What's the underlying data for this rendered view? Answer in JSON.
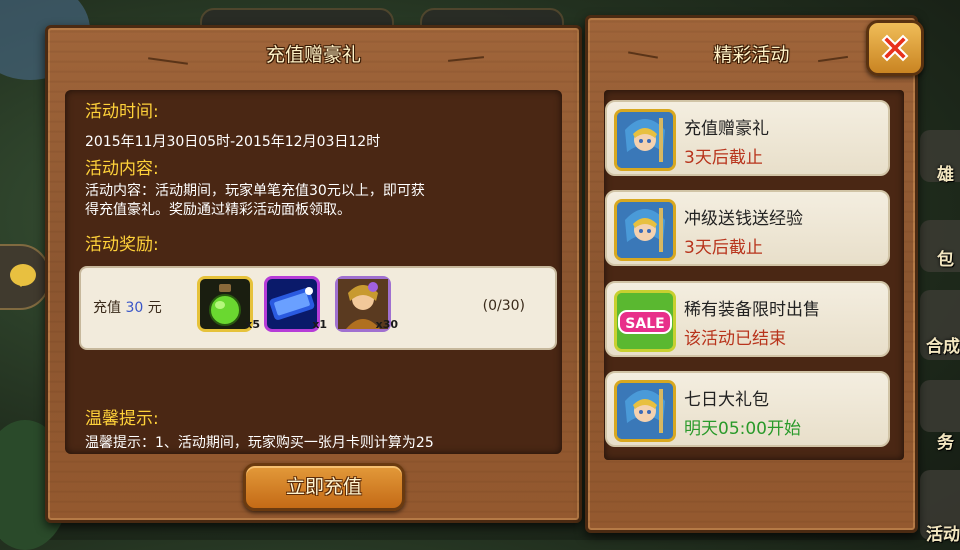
{
  "background": {
    "side_labels": [
      "雄",
      "包",
      "合成",
      "务",
      "活动"
    ]
  },
  "left_panel": {
    "title": "充值赠豪礼",
    "time_heading": "活动时间:",
    "time_text": "2015年11月30日05时-2015年12月03日12时",
    "content_heading": "活动内容:",
    "content_line1": "活动内容：活动期间，玩家单笔充值30元以上，即可获",
    "content_line2": "得充值豪礼。奖励通过精彩活动面板领取。",
    "reward_heading": "活动奖励:",
    "reward_row": {
      "label_prefix": "充值",
      "amount": "30",
      "label_suffix": "元",
      "items": [
        {
          "icon": "green-potion-icon",
          "count": "x5"
        },
        {
          "icon": "blue-scroll-icon",
          "count": "x1"
        },
        {
          "icon": "hero-portrait-icon",
          "count": "x30"
        }
      ],
      "progress": "(0/30)"
    },
    "tip_heading": "温馨提示:",
    "tip_text": "温馨提示：1、活动期间，玩家购买一张月卡则计算为25",
    "recharge_button": "立即充值"
  },
  "right_panel": {
    "title": "精彩活动",
    "close_icon": "close-x-icon",
    "events": [
      {
        "name": "充值赠豪礼",
        "status": "3天后截止",
        "status_color": "#b8341c",
        "icon": "hero-portrait-icon"
      },
      {
        "name": "冲级送钱送经验",
        "status": "3天后截止",
        "status_color": "#b8341c",
        "icon": "hero-portrait-icon"
      },
      {
        "name": "稀有装备限时出售",
        "status": "该活动已结束",
        "status_color": "#b8341c",
        "icon": "sale-badge-icon",
        "icon_text": "SALE"
      },
      {
        "name": "七日大礼包",
        "status": "明天05:00开始",
        "status_color": "#2a9a2a",
        "icon": "hero-portrait-icon"
      }
    ]
  }
}
